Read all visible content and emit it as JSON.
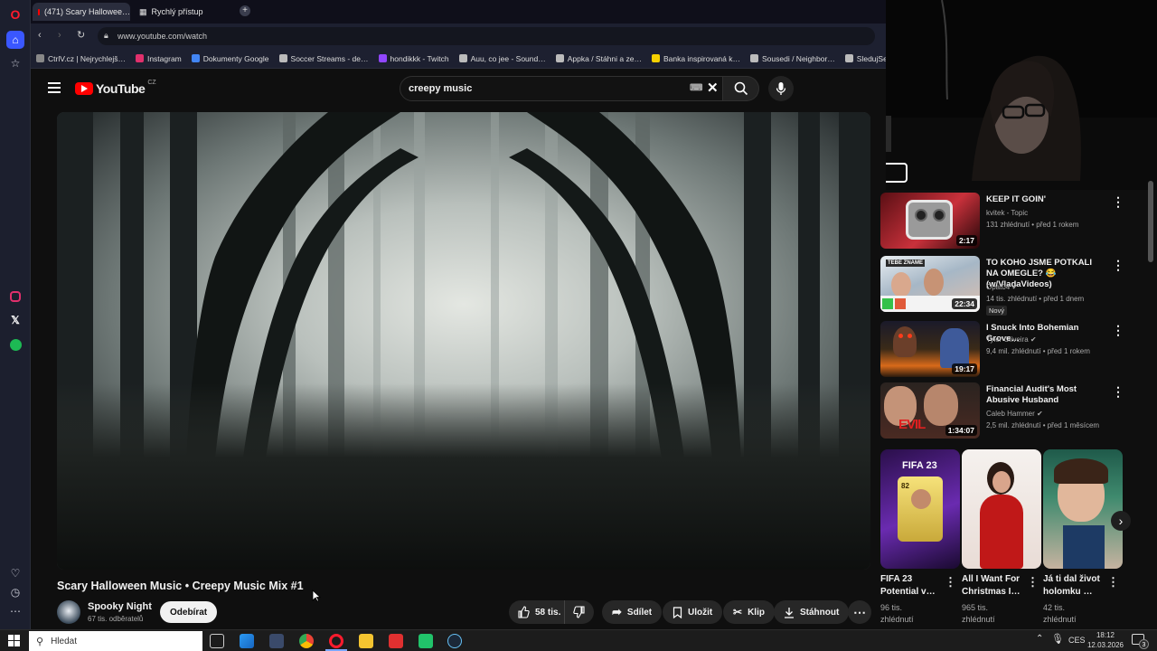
{
  "browser": {
    "tabs": [
      {
        "label": "(471) Scary Hallowee…",
        "active": true
      },
      {
        "label": "Rychlý přístup",
        "active": false
      }
    ],
    "url": "www.youtube.com/watch",
    "bookmarks": [
      {
        "label": "CtrlV.cz | Nejrychlejš…",
        "color": "#888888"
      },
      {
        "label": "Instagram",
        "color": "#e1306c"
      },
      {
        "label": "Dokumenty Google",
        "color": "#4285f4"
      },
      {
        "label": "Soccer Streams - de…",
        "color": "#bbbbbb"
      },
      {
        "label": "hondikkk - Twitch",
        "color": "#9146ff"
      },
      {
        "label": "Auu, co jee - Sound…",
        "color": "#bbbbbb"
      },
      {
        "label": "Appka / Stáhni a ze…",
        "color": "#bbbbbb"
      },
      {
        "label": "Banka inspirovaná k…",
        "color": "#f5d000"
      },
      {
        "label": "Sousedi / Neighbor…",
        "color": "#bbbbbb"
      },
      {
        "label": "SledujSerialy.to: Prů…",
        "color": "#bbbbbb"
      }
    ]
  },
  "youtube": {
    "logo": "YouTube",
    "region": "CZ",
    "search_query": "creepy music",
    "video": {
      "title": "Scary Halloween Music • Creepy Music Mix #1",
      "channel": "Spooky Night",
      "subscribers": "67 tis. odběratelů",
      "subscribe_label": "Odebírat",
      "likes": "58 tis.",
      "share_label": "Sdílet",
      "save_label": "Uložit",
      "clip_label": "Klip",
      "download_label": "Stáhnout"
    },
    "recommendations": [
      {
        "title": "KEEP IT GOIN'",
        "channel": "kvitek - Topic",
        "meta": "131 zhlédnutí • před 1 rokem",
        "duration": "2:17",
        "verified": false,
        "badge": ""
      },
      {
        "title": "TO KOHO JSME POTKALI NA OMEGLE? 😂 (w/VladaVideos)",
        "channel": "Opat04",
        "meta": "14 tis. zhlédnutí • před 1 dnem",
        "duration": "22:34",
        "verified": true,
        "badge": "Nový"
      },
      {
        "title": "I Snuck Into Bohemian Grove…",
        "channel": "Tyler Oliveira",
        "meta": "9,4 mil. zhlédnutí • před 1 rokem",
        "duration": "19:17",
        "verified": true,
        "badge": ""
      },
      {
        "title": "Financial Audit's Most Abusive Husband",
        "channel": "Caleb Hammer",
        "meta": "2,5 mil. zhlédnutí • před 1 měsícem",
        "duration": "1:34:07",
        "verified": true,
        "badge": ""
      }
    ],
    "shorts": [
      {
        "title": "FIFA 23 Potential v…",
        "views": "96 tis. zhlédnutí"
      },
      {
        "title": "All I Want For Christmas I…",
        "views": "965 tis. zhlédnutí"
      },
      {
        "title": "Já ti dal život holomku …",
        "views": "42 tis. zhlédnutí"
      }
    ],
    "short_thumb_text": {
      "fifa": "FIFA 23",
      "rating": "82",
      "evil": "EVIL",
      "card_label": "TEBE ZNAME"
    }
  },
  "taskbar": {
    "search_placeholder": "Hledat",
    "language": "CES",
    "time": "18:12",
    "date": "12.03.2026",
    "notification_count": "3"
  }
}
